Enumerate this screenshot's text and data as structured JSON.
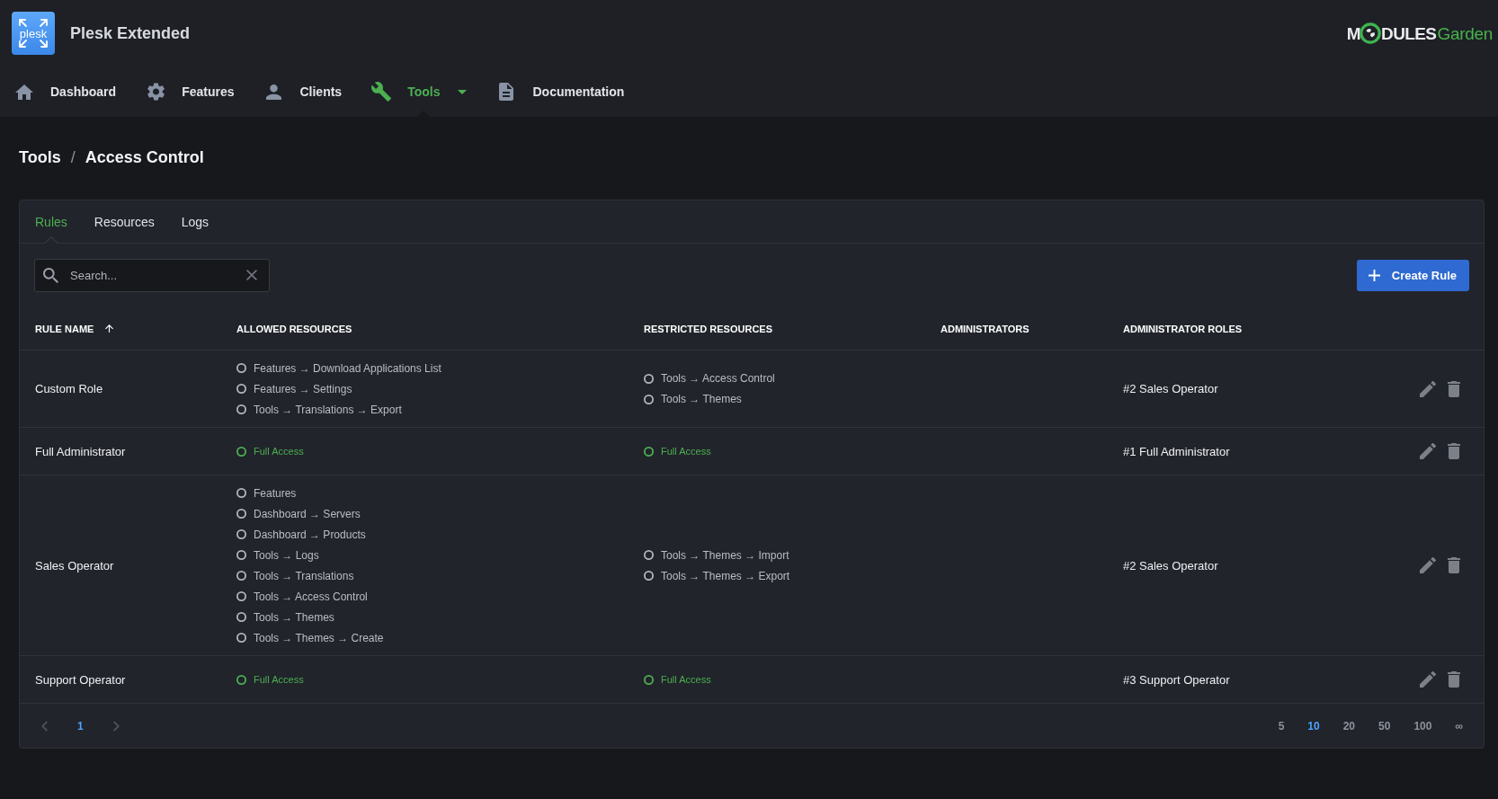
{
  "header": {
    "app_logo": "plesk",
    "app_title": "Plesk Extended",
    "brand_logo": {
      "lead": "M",
      "bold": "DULES",
      "light": "Garden"
    }
  },
  "nav": [
    {
      "label": "Dashboard",
      "selected": false,
      "has_menu": false
    },
    {
      "label": "Features",
      "selected": false,
      "has_menu": false
    },
    {
      "label": "Clients",
      "selected": false,
      "has_menu": false
    },
    {
      "label": "Tools",
      "selected": true,
      "has_menu": true
    },
    {
      "label": "Documentation",
      "selected": false,
      "has_menu": false
    }
  ],
  "breadcrumb": {
    "items": [
      "Tools",
      "Access Control"
    ],
    "separator": "/"
  },
  "tabs": [
    {
      "label": "Rules",
      "selected": true
    },
    {
      "label": "Resources",
      "selected": false
    },
    {
      "label": "Logs",
      "selected": false
    }
  ],
  "search": {
    "placeholder": "Search..."
  },
  "create_button": {
    "label": "Create Rule"
  },
  "table": {
    "columns": [
      {
        "label": "RULE NAME",
        "sorted": true
      },
      {
        "label": "ALLOWED RESOURCES",
        "sorted": false
      },
      {
        "label": "RESTRICTED RESOURCES",
        "sorted": false
      },
      {
        "label": "ADMINISTRATORS",
        "sorted": false
      },
      {
        "label": "ADMINISTRATOR ROLES",
        "sorted": false
      }
    ],
    "rows": [
      {
        "rule_name": "Custom Role",
        "allowed_resources": [
          {
            "label": "Features → Download Applications List",
            "kind": "path"
          },
          {
            "label": "Features → Settings",
            "kind": "path"
          },
          {
            "label": "Tools → Translations → Export",
            "kind": "path"
          }
        ],
        "restricted_resources": [
          {
            "label": "Tools → Access Control",
            "kind": "path"
          },
          {
            "label": "Tools → Themes",
            "kind": "path"
          }
        ],
        "administrator_roles": "#2 Sales Operator"
      },
      {
        "rule_name": "Full Administrator",
        "allowed_resources": [
          {
            "label": "Full Access",
            "kind": "full_access"
          }
        ],
        "restricted_resources": [
          {
            "label": "Full Access",
            "kind": "full_access"
          }
        ],
        "administrator_roles": "#1 Full Administrator"
      },
      {
        "rule_name": "Sales Operator",
        "allowed_resources": [
          {
            "label": "Features",
            "kind": "path"
          },
          {
            "label": "Dashboard → Servers",
            "kind": "path"
          },
          {
            "label": "Dashboard → Products",
            "kind": "path"
          },
          {
            "label": "Tools → Logs",
            "kind": "path"
          },
          {
            "label": "Tools → Translations",
            "kind": "path"
          },
          {
            "label": "Tools → Access Control",
            "kind": "path"
          },
          {
            "label": "Tools → Themes",
            "kind": "path"
          },
          {
            "label": "Tools → Themes → Create",
            "kind": "path"
          }
        ],
        "restricted_resources": [
          {
            "label": "Tools → Themes → Import",
            "kind": "path"
          },
          {
            "label": "Tools → Themes → Export",
            "kind": "path"
          }
        ],
        "administrator_roles": "#2 Sales Operator"
      },
      {
        "rule_name": "Support Operator",
        "allowed_resources": [
          {
            "label": "Full Access",
            "kind": "full_access"
          }
        ],
        "restricted_resources": [
          {
            "label": "Full Access",
            "kind": "full_access"
          }
        ],
        "administrator_roles": "#3 Support Operator"
      }
    ]
  },
  "pagination": {
    "prev": {
      "disabled": true
    },
    "pages": [
      {
        "label": "1",
        "selected": true
      }
    ],
    "next": {
      "disabled": true
    },
    "page_sizes": [
      {
        "label": "5",
        "selected": false
      },
      {
        "label": "10",
        "selected": true
      },
      {
        "label": "20",
        "selected": false
      },
      {
        "label": "50",
        "selected": false
      },
      {
        "label": "100",
        "selected": false
      },
      {
        "label": "∞",
        "selected": false
      }
    ]
  }
}
